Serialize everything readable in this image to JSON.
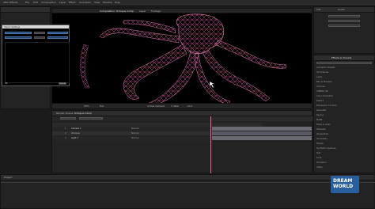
{
  "menubar": {
    "items": [
      "After Effects",
      "File",
      "Edit",
      "Composition",
      "Layer",
      "Effect",
      "Animation",
      "View",
      "Window",
      "Help"
    ]
  },
  "viewer": {
    "tabs": [
      "Composition: Octopus Comp",
      "Layer",
      "Footage"
    ],
    "footer": [
      "25%",
      "Full",
      "Active Camera",
      "1 View",
      "+0.0"
    ]
  },
  "dialog": {
    "title": "Import Settings",
    "ok": "OK",
    "cancel": "Cancel"
  },
  "right_panel": {
    "tabs": [
      "Info",
      "Audio"
    ],
    "effects_title": "Effects & Presets",
    "items": [
      "Animation Presets",
      "3D Channel",
      "Audio",
      "Blur & Sharpen",
      "Channel",
      "CINEMA 4D",
      "Color Correction",
      "Distort",
      "Expression Controls",
      "Generate",
      "Keying",
      "Matte",
      "Noise & Grain",
      "Obsolete",
      "Perspective",
      "Simulation",
      "Stylize",
      "Synthetic Aperture",
      "Text",
      "Time",
      "Transition",
      "Utility"
    ]
  },
  "timeline": {
    "tabs": [
      "Render Queue",
      "Octopus Comp"
    ],
    "layers": [
      {
        "num": "1",
        "name": "Camera 1",
        "mode": "Normal",
        "color": "#c8c8c8"
      },
      {
        "num": "2",
        "name": "Octopus",
        "mode": "Normal",
        "color": "#d64fbf"
      },
      {
        "num": "3",
        "name": "Light 1",
        "mode": "Normal",
        "color": "#c8c8c8"
      }
    ]
  },
  "project_panel": {
    "title": "Project"
  },
  "watermark": {
    "line1": "DREAM",
    "line2": "WORLD"
  },
  "colors": {
    "accent": "#f06aa0",
    "mesh": "#d65d9a",
    "panel": "#232323",
    "blue_field": "#1f3f66"
  }
}
